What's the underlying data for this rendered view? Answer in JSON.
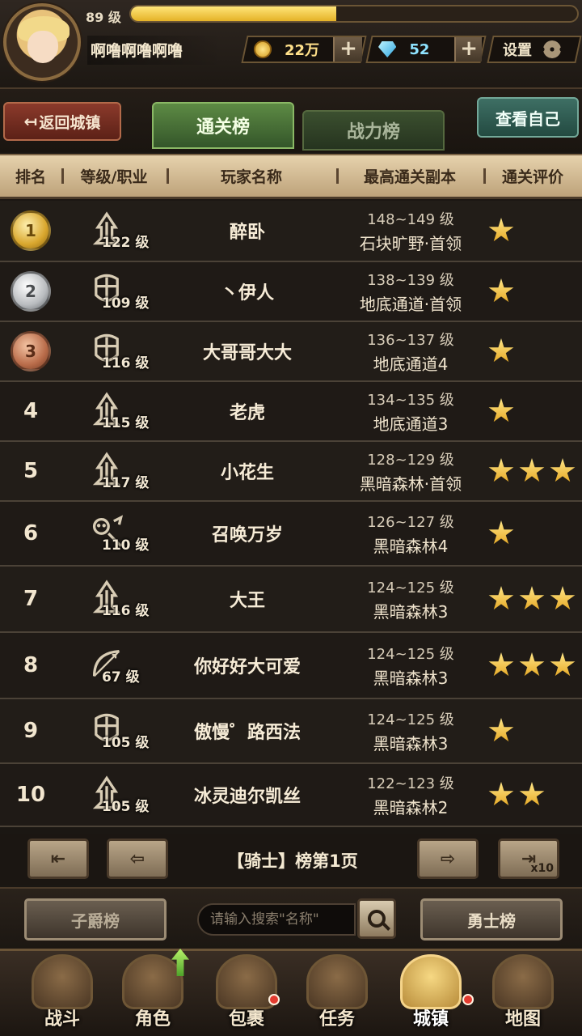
{
  "player": {
    "level_text": "89 级",
    "xp_fraction": 0.46,
    "name": "啊噜啊噜啊噜"
  },
  "currency": {
    "gold": "22万",
    "gems": "52",
    "plus": "+"
  },
  "settings_label": "设置",
  "nav": {
    "back_label": "返回城镇",
    "tab_clear": "通关榜",
    "tab_power": "战力榜",
    "view_self": "查看自己"
  },
  "table": {
    "headers": {
      "rank": "排名",
      "level_class": "等级/职业",
      "player_name": "玩家名称",
      "best_dungeon": "最高通关副本",
      "rating": "通关评价"
    },
    "rows": [
      {
        "rank": "1",
        "level": "122 级",
        "class_icon": "knight-crest-icon",
        "name": "醉卧",
        "range": "148~149 级",
        "dungeon": "石块旷野·首领",
        "stars": 1
      },
      {
        "rank": "2",
        "level": "109 级",
        "class_icon": "shield-cross-icon",
        "name": "丶伊人",
        "range": "138~139 级",
        "dungeon": "地底通道·首领",
        "stars": 1
      },
      {
        "rank": "3",
        "level": "116 级",
        "class_icon": "shield-cross-icon",
        "name": "大哥哥大大",
        "range": "136~137 级",
        "dungeon": "地底通道4",
        "stars": 1
      },
      {
        "rank": "4",
        "level": "115 级",
        "class_icon": "knight-crest-icon",
        "name": "老虎",
        "range": "134~135 级",
        "dungeon": "地底通道3",
        "stars": 1
      },
      {
        "rank": "5",
        "level": "117 级",
        "class_icon": "knight-crest-icon",
        "name": "小花生",
        "range": "128~129 级",
        "dungeon": "黑暗森林·首领",
        "stars": 3
      },
      {
        "rank": "6",
        "level": "110 级",
        "class_icon": "summoner-skull-icon",
        "name": "召唤万岁",
        "range": "126~127 级",
        "dungeon": "黑暗森林4",
        "stars": 1
      },
      {
        "rank": "7",
        "level": "116 级",
        "class_icon": "knight-crest-icon",
        "name": "大王",
        "range": "124~125 级",
        "dungeon": "黑暗森林3",
        "stars": 3
      },
      {
        "rank": "8",
        "level": "67 级",
        "class_icon": "bow-icon",
        "name": "你好好大可爱",
        "range": "124~125 级",
        "dungeon": "黑暗森林3",
        "stars": 3
      },
      {
        "rank": "9",
        "level": "105 级",
        "class_icon": "shield-cross-icon",
        "name": "傲慢゜路西法",
        "range": "124~125 级",
        "dungeon": "黑暗森林3",
        "stars": 1
      },
      {
        "rank": "10",
        "level": "105 级",
        "class_icon": "knight-crest-icon",
        "name": "冰灵迪尔凯丝",
        "range": "122~123 级",
        "dungeon": "黑暗森林2",
        "stars": 2
      }
    ]
  },
  "pagination": {
    "label": "【骑士】榜第1页",
    "x10": "x10"
  },
  "search": {
    "placeholder": "请输入搜索\"名称\"",
    "viscount_btn": "子爵榜",
    "warrior_btn": "勇士榜"
  },
  "bottom_nav": [
    {
      "id": "battle",
      "label": "战斗",
      "icon": "crossed-swords-icon"
    },
    {
      "id": "character",
      "label": "角色",
      "icon": "helmet-icon"
    },
    {
      "id": "bag",
      "label": "包裹",
      "icon": "backpack-icon"
    },
    {
      "id": "quest",
      "label": "任务",
      "icon": "scroll-icon"
    },
    {
      "id": "town",
      "label": "城镇",
      "icon": "castle-icon"
    },
    {
      "id": "map",
      "label": "地图",
      "icon": "map-icon"
    }
  ]
}
